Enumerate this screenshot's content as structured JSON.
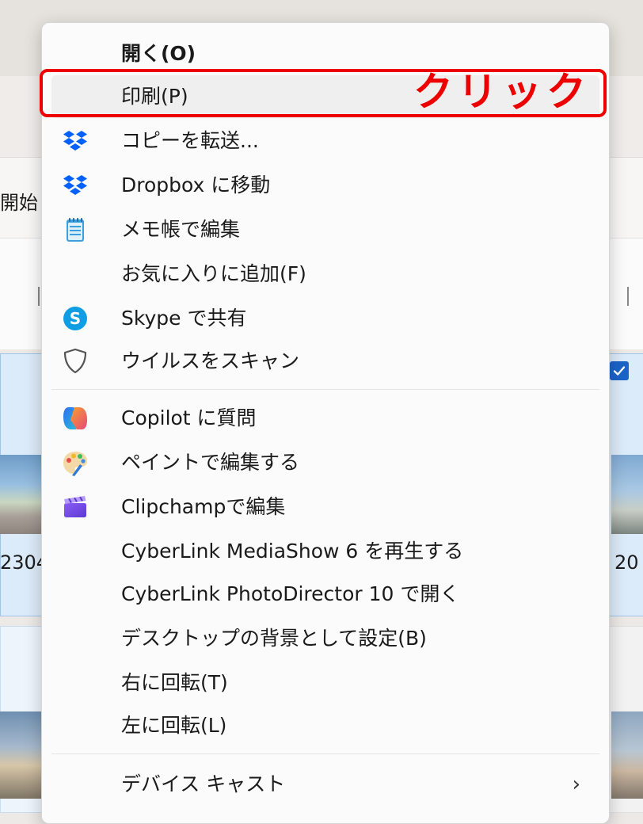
{
  "background": {
    "partial_label": "開始",
    "file_number_left": "2304",
    "file_number_right": "20"
  },
  "menu": {
    "items": [
      {
        "id": "open",
        "label": "開く(O)",
        "icon": ""
      },
      {
        "id": "print",
        "label": "印刷(P)",
        "icon": ""
      },
      {
        "id": "forward-copy",
        "label": "コピーを転送...",
        "icon": "dropbox-icon"
      },
      {
        "id": "move-dropbox",
        "label": "Dropbox に移動",
        "icon": "dropbox-icon"
      },
      {
        "id": "edit-notepad",
        "label": "メモ帳で編集",
        "icon": "notepad-icon"
      },
      {
        "id": "add-favorites",
        "label": "お気に入りに追加(F)",
        "icon": ""
      },
      {
        "id": "share-skype",
        "label": "Skype で共有",
        "icon": "skype-icon"
      },
      {
        "id": "virus-scan",
        "label": "ウイルスをスキャン",
        "icon": "shield-icon"
      },
      {
        "id": "ask-copilot",
        "label": "Copilot に質問",
        "icon": "copilot-icon"
      },
      {
        "id": "edit-paint",
        "label": "ペイントで編集する",
        "icon": "paint-icon"
      },
      {
        "id": "edit-clipchamp",
        "label": "Clipchampで編集",
        "icon": "clipchamp-icon"
      },
      {
        "id": "play-mediashow",
        "label": "CyberLink MediaShow 6 を再生する",
        "icon": ""
      },
      {
        "id": "open-photodirector",
        "label": "CyberLink PhotoDirector 10 で開く",
        "icon": ""
      },
      {
        "id": "set-desktop-bg",
        "label": "デスクトップの背景として設定(B)",
        "icon": ""
      },
      {
        "id": "rotate-right",
        "label": "右に回転(T)",
        "icon": ""
      },
      {
        "id": "rotate-left",
        "label": "左に回転(L)",
        "icon": ""
      },
      {
        "id": "device-cast",
        "label": "デバイス キャスト",
        "icon": "chevron-right-icon",
        "submenu_indicator": "›"
      }
    ]
  },
  "annotation": {
    "callout_text": "クリック",
    "color": "#ee0000"
  },
  "colors": {
    "dropbox": "#0061fe",
    "skype": "#0f9ee3",
    "notepad": "#3aa0e0",
    "highlight": "#ee0000"
  }
}
